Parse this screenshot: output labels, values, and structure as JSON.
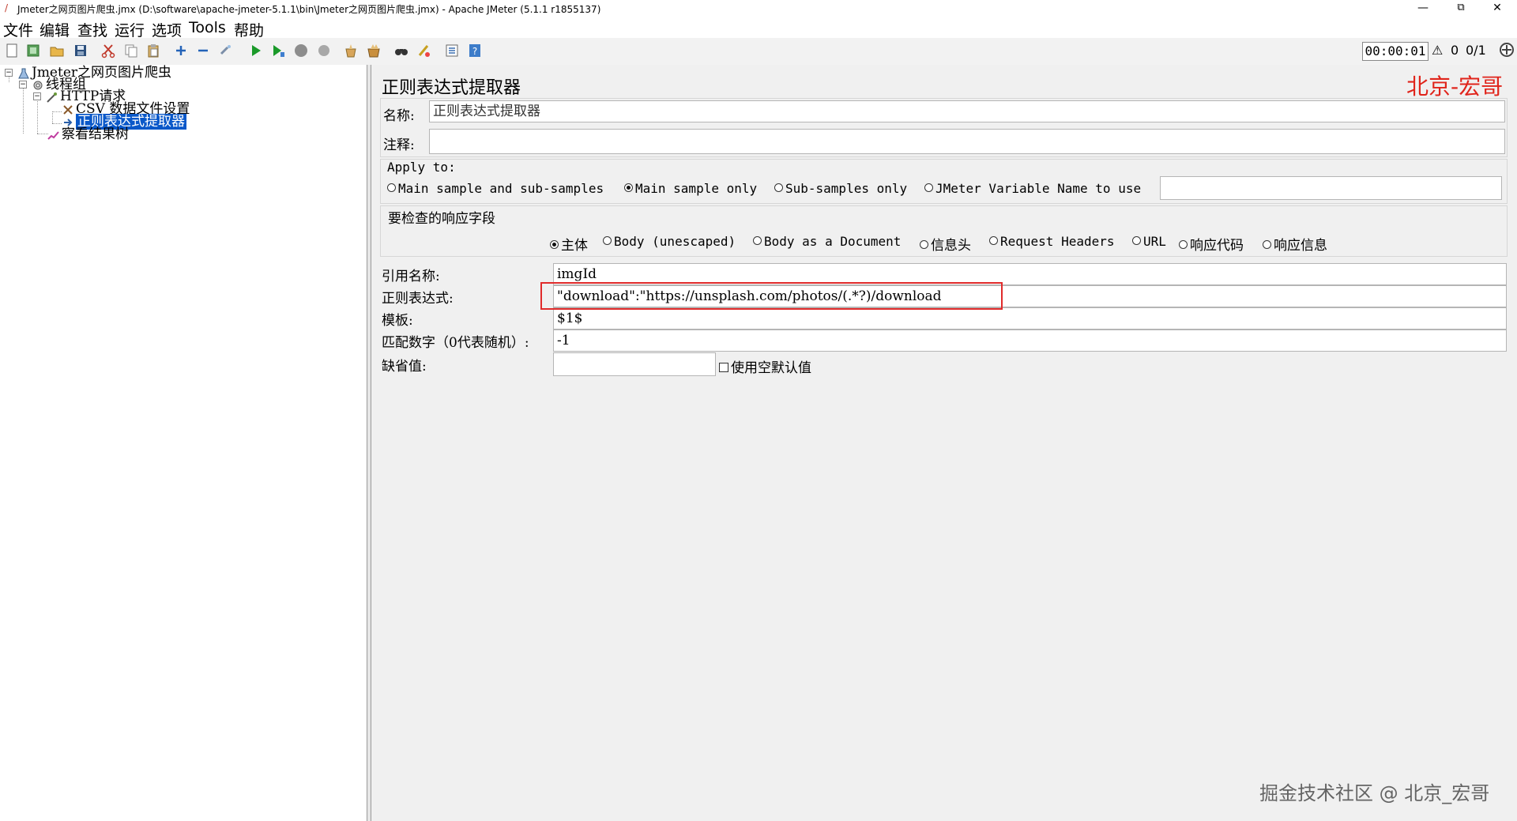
{
  "window": {
    "title": "Jmeter之网页图片爬虫.jmx (D:\\software\\apache-jmeter-5.1.1\\bin\\Jmeter之网页图片爬虫.jmx) - Apache JMeter (5.1.1 r1855137)",
    "minimize": "—",
    "restore": "⧉",
    "close": "✕"
  },
  "menu": [
    "文件",
    "编辑",
    "查找",
    "运行",
    "选项",
    "Tools",
    "帮助"
  ],
  "toolbar": {
    "timer": "00:00:01",
    "warning_count": "0",
    "threads": "0/1",
    "icons": [
      "new-icon",
      "templates-icon",
      "open-icon",
      "save-icon",
      "cut-icon",
      "copy-icon",
      "paste-icon",
      "expand-icon",
      "collapse-icon",
      "toggle-icon",
      "start-icon",
      "start-no-pause-icon",
      "stop-icon",
      "shutdown-icon",
      "clear-icon",
      "clear-all-icon",
      "search-icon",
      "reset-search-icon",
      "function-helper-icon",
      "help-icon"
    ]
  },
  "tree": {
    "items": [
      {
        "label": "Jmeter之网页图片爬虫",
        "level": 0
      },
      {
        "label": "线程组",
        "level": 1
      },
      {
        "label": "HTTP请求",
        "level": 2
      },
      {
        "label": "CSV 数据文件设置",
        "level": 3
      },
      {
        "label": "正则表达式提取器",
        "level": 3,
        "selected": true
      },
      {
        "label": "察看结果树",
        "level": 2
      }
    ]
  },
  "panel": {
    "title": "正则表达式提取器",
    "watermark_top": "北京-宏哥",
    "name_label": "名称:",
    "name_value": "正则表达式提取器",
    "comment_label": "注释:",
    "comment_value": "",
    "apply_to": {
      "label": "Apply to:",
      "options": [
        "Main sample and sub-samples",
        "Main sample only",
        "Sub-samples only",
        "JMeter Variable Name to use"
      ],
      "selected": "Main sample only",
      "variable_value": ""
    },
    "field_to_check": {
      "label": "要检查的响应字段",
      "options": [
        "主体",
        "Body (unescaped)",
        "Body as a Document",
        "信息头",
        "Request Headers",
        "URL",
        "响应代码",
        "响应信息"
      ],
      "selected": "主体"
    },
    "ref_name_label": "引用名称:",
    "ref_name_value": "imgId",
    "regex_label": "正则表达式:",
    "regex_value": "\"download\":\"https://unsplash.com/photos/(.*?)/download",
    "template_label": "模板:",
    "template_value": "$1$",
    "match_no_label": "匹配数字（0代表随机）:",
    "match_no_value": "-1",
    "default_label": "缺省值:",
    "default_value": "",
    "use_empty_default_label": "使用空默认值",
    "use_empty_default_checked": false
  },
  "watermark_bottom": "掘金技术社区 @ 北京_宏哥",
  "colors": {
    "selection": "#0a58c9",
    "highlight_border": "#e02b2b",
    "watermark_red": "#e0241b"
  }
}
